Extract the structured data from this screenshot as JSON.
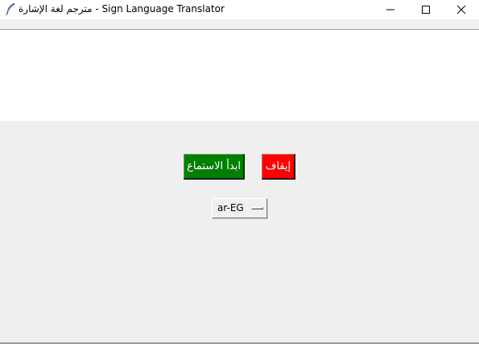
{
  "window": {
    "title": "مترجم لغة الإشارة - Sign Language Translator",
    "app_icon": "feather-icon",
    "controls": {
      "minimize_icon": "minimize-icon",
      "maximize_icon": "maximize-icon",
      "close_icon": "close-icon"
    }
  },
  "transcript": {
    "text": ""
  },
  "controls": {
    "start_button_label": "ابدأ الاستماع",
    "stop_button_label": "إيقاف",
    "language_selected": "ar-EG"
  },
  "colors": {
    "start_button": "#008000",
    "stop_button": "#ff0000",
    "panel_background": "#efefef"
  }
}
